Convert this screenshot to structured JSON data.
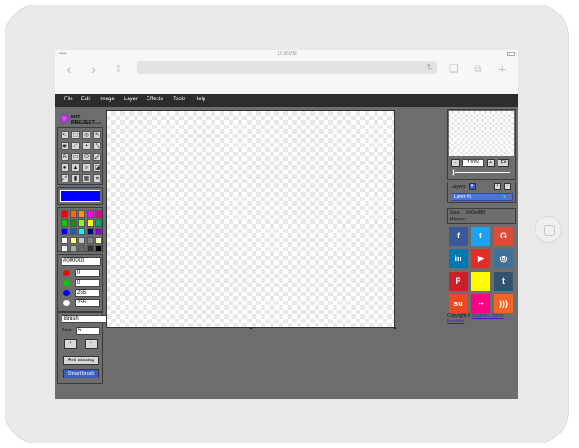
{
  "status_bar": {
    "time": "12:36 PM",
    "signal": "•••••"
  },
  "browser": {
    "back_icon": "chevron-left-icon",
    "forward_icon": "chevron-right-icon",
    "share_icon": "share-icon",
    "reload_icon": "reload-icon",
    "bookmarks_icon": "book-icon",
    "tabs_icon": "tabs-icon",
    "new_tab_icon": "plus-icon"
  },
  "menu": [
    "File",
    "Edit",
    "Image",
    "Layer",
    "Effects",
    "Tools",
    "Help"
  ],
  "logo": {
    "title": "MIT PROJECT",
    "subtitle": "creative ∙ original ∙ useful"
  },
  "tools": [
    {
      "icon": "select-arrow-icon",
      "glyph": "↖"
    },
    {
      "icon": "marquee-icon",
      "glyph": "⬚"
    },
    {
      "icon": "lasso-icon",
      "glyph": "◎"
    },
    {
      "icon": "pencil-icon",
      "glyph": "✎"
    },
    {
      "icon": "fill-bucket-icon",
      "glyph": "◉"
    },
    {
      "icon": "eyedropper-icon",
      "glyph": "⁄"
    },
    {
      "icon": "magic-wand-icon",
      "glyph": "✦"
    },
    {
      "icon": "line-icon",
      "glyph": "╲"
    },
    {
      "icon": "text-icon",
      "glyph": "A"
    },
    {
      "icon": "rectangle-icon",
      "glyph": "▭"
    },
    {
      "icon": "ellipse-icon",
      "glyph": "⬭"
    },
    {
      "icon": "brush-icon",
      "glyph": "🖌"
    },
    {
      "icon": "drop-icon",
      "glyph": "●"
    },
    {
      "icon": "shape-icon",
      "glyph": "▲"
    },
    {
      "icon": "zoom-icon",
      "glyph": "⌕"
    },
    {
      "icon": "eraser-icon",
      "glyph": "◪"
    },
    {
      "icon": "clone-icon",
      "glyph": "⤢"
    },
    {
      "icon": "gradient-icon",
      "glyph": "▮"
    },
    {
      "icon": "blur-icon",
      "glyph": "▦"
    },
    {
      "icon": "crop-icon",
      "glyph": "⌗"
    }
  ],
  "current_color": "#0000ff",
  "palette": [
    "#ff0000",
    "#ff6a00",
    "#ff9900",
    "#ff00ff",
    "#e00099",
    "#00cc00",
    "#009900",
    "#88ff00",
    "#ffff00",
    "#00aa66",
    "#0000ff",
    "#0066cc",
    "#00ffff",
    "#000080",
    "#8800cc",
    "#ffffff",
    "#ffff66",
    "#c8c8c8",
    "#808080",
    "#ffffbb",
    "#eeeeee",
    "#aaaaaa",
    "#666666",
    "#333333",
    "#000000"
  ],
  "color_inputs": {
    "hex": "#000000",
    "channels": [
      {
        "color": "#ff0000",
        "value": "0"
      },
      {
        "color": "#00cc00",
        "value": "0"
      },
      {
        "color": "#0000ff",
        "value": "255"
      },
      {
        "color": "#ffffff",
        "value": "255"
      }
    ]
  },
  "brush": {
    "type": "Brush",
    "size_label": "Size:",
    "size": "5",
    "plus": "+",
    "minus": "-",
    "anti_aliasing": "Anti aliasing",
    "smart_brush": "Smart brush"
  },
  "navigator": {
    "zoom_out": "-",
    "zoom": "100%",
    "zoom_in": "+",
    "fit": "Fit",
    "zoom_level_fraction": 0.0
  },
  "layers": {
    "title": "Layers",
    "items": [
      "Layer #1"
    ]
  },
  "info": {
    "size_label": "Size:",
    "size": "640x480",
    "mouse_label": "Mouse:",
    "mouse": ""
  },
  "social": [
    {
      "name": "facebook",
      "color": "#3b5998",
      "glyph": "f"
    },
    {
      "name": "twitter",
      "color": "#1da1f2",
      "glyph": "t"
    },
    {
      "name": "google",
      "color": "#dd4b39",
      "glyph": "G"
    },
    {
      "name": "linkedin",
      "color": "#0077b5",
      "glyph": "in"
    },
    {
      "name": "youtube",
      "color": "#e52d27",
      "glyph": "▶"
    },
    {
      "name": "instagram",
      "color": "#3f729b",
      "glyph": "◎"
    },
    {
      "name": "pinterest",
      "color": "#cb2027",
      "glyph": "P"
    },
    {
      "name": "snapchat",
      "color": "#fffc00",
      "glyph": "◔"
    },
    {
      "name": "tumblr",
      "color": "#34526f",
      "glyph": "t"
    },
    {
      "name": "stumbleupon",
      "color": "#eb4924",
      "glyph": "su"
    },
    {
      "name": "flickr",
      "color": "#ff0084",
      "glyph": "••"
    },
    {
      "name": "rss",
      "color": "#f26522",
      "glyph": ")))"
    }
  ],
  "copyright": {
    "prefix": "Copyright ©",
    "link": "Szabolcs Istvan Kisabbel"
  }
}
